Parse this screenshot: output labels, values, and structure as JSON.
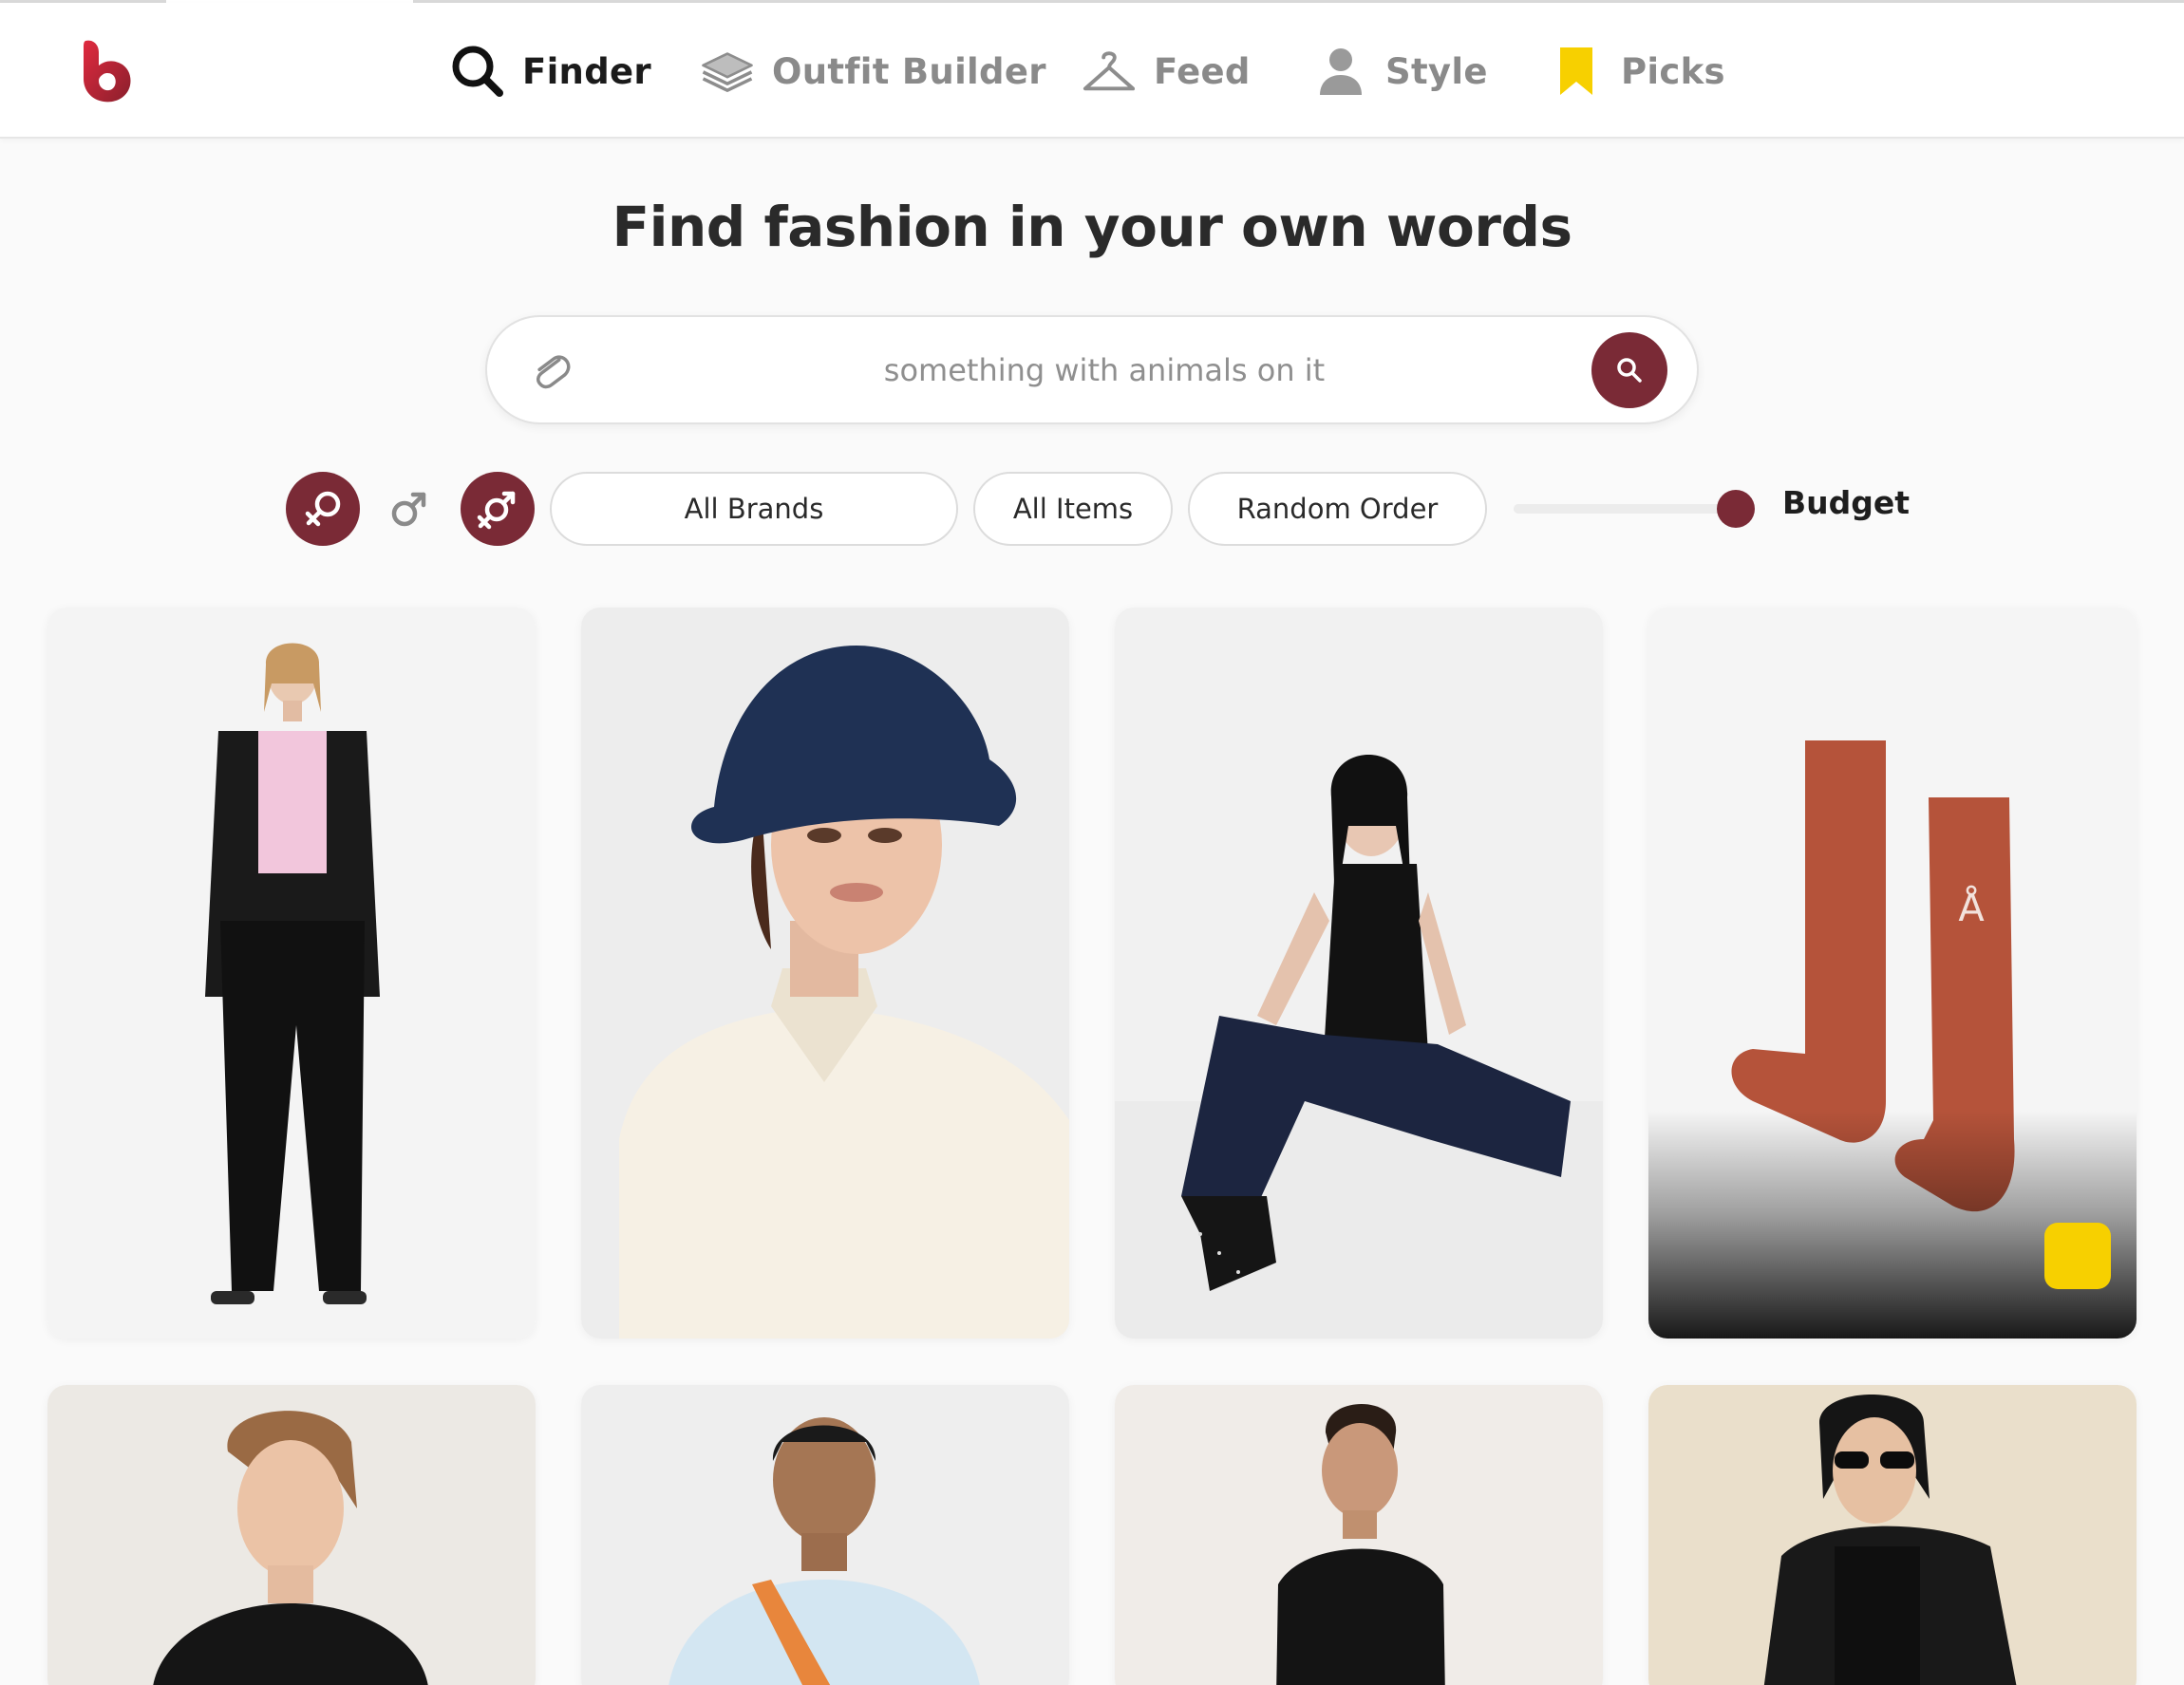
{
  "app": {
    "logo_icon": "brand-b-logo-icon",
    "accent_color": "#7a2a36",
    "highlight_color": "#f7d000"
  },
  "nav": {
    "items": [
      {
        "label": "Finder",
        "icon": "search-icon",
        "active": true
      },
      {
        "label": "Outfit Builder",
        "icon": "layers-icon",
        "active": false
      },
      {
        "label": "Feed",
        "icon": "hanger-icon",
        "active": false
      },
      {
        "label": "Style",
        "icon": "person-icon",
        "active": false
      },
      {
        "label": "Picks",
        "icon": "bookmark-icon",
        "active": false
      }
    ]
  },
  "hero": {
    "title": "Find fashion in your own words"
  },
  "search": {
    "placeholder": "something with animals on it",
    "value": "",
    "attach_icon": "paperclip-icon",
    "submit_icon": "search-icon"
  },
  "filters": {
    "gender_buttons": [
      {
        "icon": "female-symbol-icon",
        "selected": true
      },
      {
        "icon": "male-symbol-icon",
        "selected": false
      },
      {
        "icon": "unisex-symbol-icon",
        "selected": true
      }
    ],
    "brands": "All Brands",
    "items": "All Items",
    "order": "Random Order",
    "budget_label": "Budget",
    "budget_level": 1.0
  },
  "products": [
    {
      "desc": "woman in black suit with pink top"
    },
    {
      "desc": "woman in navy bucket hat and cream shirt"
    },
    {
      "desc": "woman in black tank top and dark jeans"
    },
    {
      "desc": "rust orange ribbed socks",
      "saved": true
    },
    {
      "desc": "smiling woman in black top"
    },
    {
      "desc": "man in light blue tee with orange bag"
    },
    {
      "desc": "woman in black scoop neck dress"
    },
    {
      "desc": "woman in black blazer and sunglasses"
    }
  ]
}
